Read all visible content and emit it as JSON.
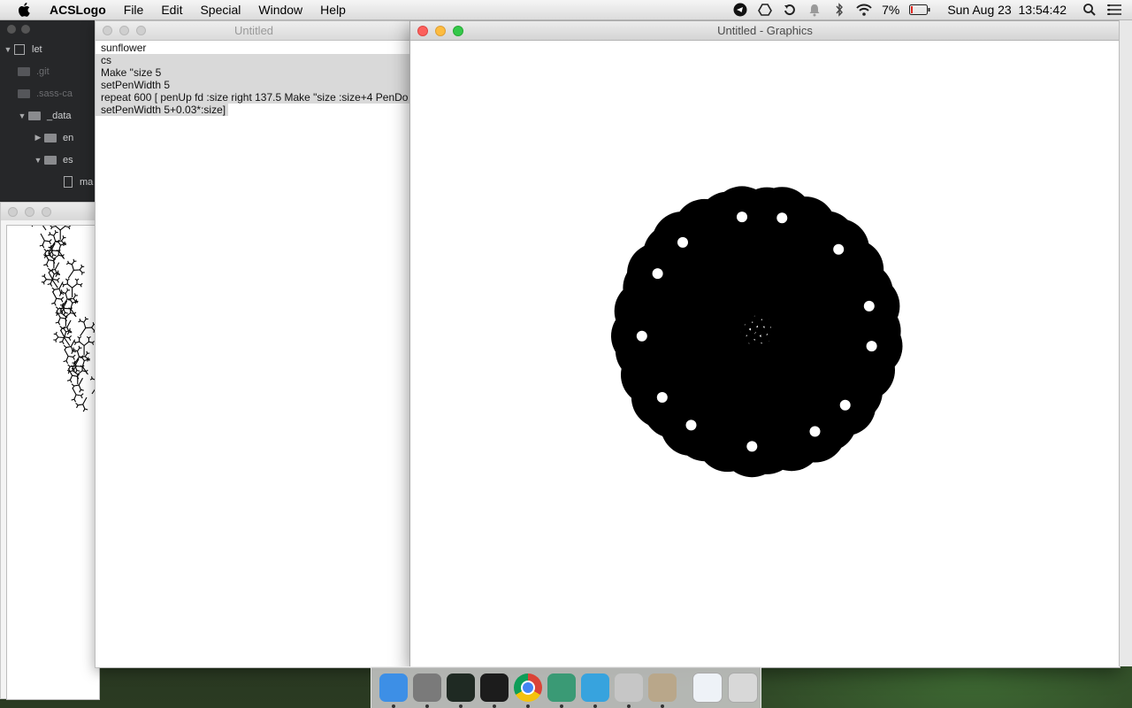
{
  "menubar": {
    "app_name": "ACSLogo",
    "menus": [
      "File",
      "Edit",
      "Special",
      "Window",
      "Help"
    ],
    "battery": "7%",
    "datetime": "Sun Aug 23  13:54:42"
  },
  "editor_tree": {
    "items": [
      {
        "label": "let",
        "kind": "root"
      },
      {
        "label": ".git",
        "kind": "folder-dim"
      },
      {
        "label": ".sass-ca",
        "kind": "folder-dim"
      },
      {
        "label": "_data",
        "kind": "folder-open"
      },
      {
        "label": "en",
        "kind": "folder"
      },
      {
        "label": "es",
        "kind": "folder-open"
      },
      {
        "label": "ma",
        "kind": "file"
      }
    ]
  },
  "code_window": {
    "title": "Untitled",
    "lines": [
      "sunflower",
      "cs",
      "Make \"size 5",
      "setPenWidth 5",
      "repeat 600 [ penUp fd :size right 137.5 Make \"size :size+4 PenDo",
      "setPenWidth 5+0.03*:size]"
    ],
    "selected_lines": [
      1,
      2,
      3,
      4,
      5
    ]
  },
  "graphics_window": {
    "title": "Untitled - Graphics"
  },
  "dock": {
    "apps": [
      {
        "name": "finder-icon",
        "color": "#3d8fe6"
      },
      {
        "name": "system-preferences-icon",
        "color": "#7a7a7a"
      },
      {
        "name": "activity-monitor-icon",
        "color": "#1f2a23"
      },
      {
        "name": "terminal-icon",
        "color": "#1c1c1c"
      },
      {
        "name": "chrome-icon",
        "color": "#e6e6e6"
      },
      {
        "name": "atom-icon",
        "color": "#3a9a75"
      },
      {
        "name": "telegram-icon",
        "color": "#37a3de"
      },
      {
        "name": "script-editor-icon",
        "color": "#c6c6c6"
      },
      {
        "name": "preview-icon",
        "color": "#b9a78a"
      }
    ],
    "trailing": [
      {
        "name": "documents-stack-icon",
        "color": "#eef2f7"
      },
      {
        "name": "trash-icon",
        "color": "#d8d8d8"
      }
    ]
  }
}
